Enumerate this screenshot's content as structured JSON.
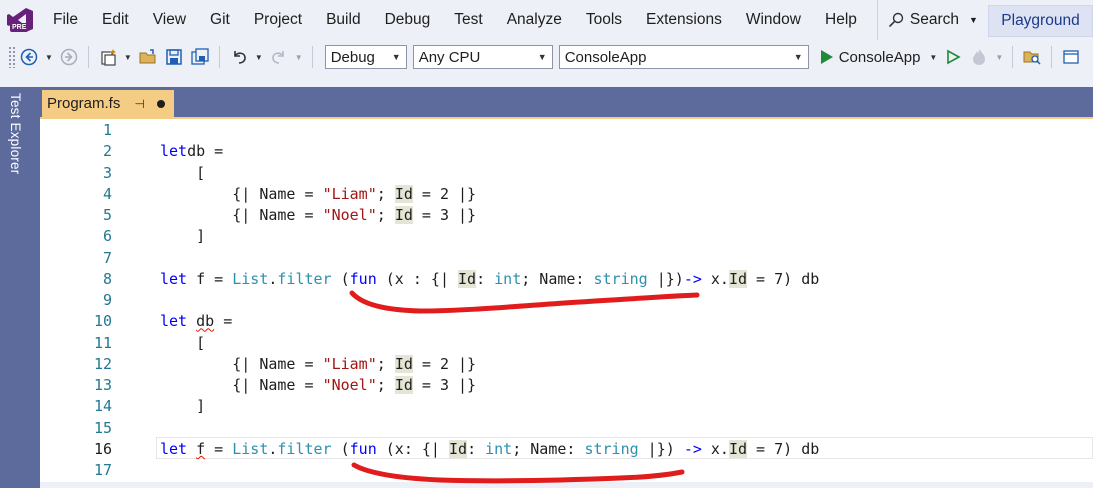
{
  "app": {
    "logo_badge": "PRE",
    "menu": [
      "File",
      "Edit",
      "View",
      "Git",
      "Project",
      "Build",
      "Debug",
      "Test",
      "Analyze",
      "Tools",
      "Extensions",
      "Window",
      "Help"
    ],
    "search_label": "Search",
    "playground_label": "Playground"
  },
  "toolbar": {
    "configuration": "Debug",
    "platform": "Any CPU",
    "project": "ConsoleApp",
    "run_label": "ConsoleApp"
  },
  "side_panel": {
    "label": "Test Explorer"
  },
  "document_tab": {
    "filename": "Program.fs",
    "modified": true
  },
  "editor": {
    "current_line": 16,
    "lines": [
      {
        "n": "1",
        "code": []
      },
      {
        "n": "2",
        "code": [
          [
            "kw",
            "let"
          ],
          [
            "",
            "db ="
          ]
        ]
      },
      {
        "n": "3",
        "code": [
          [
            "",
            "    ["
          ]
        ]
      },
      {
        "n": "4",
        "code": [
          [
            "",
            "        {| Name = "
          ],
          [
            "str",
            "\"Liam\""
          ],
          [
            "",
            "; "
          ],
          [
            "hl",
            "Id"
          ],
          [
            "",
            " = 2 |}"
          ]
        ]
      },
      {
        "n": "5",
        "code": [
          [
            "",
            "        {| Name = "
          ],
          [
            "str",
            "\"Noel\""
          ],
          [
            "",
            "; "
          ],
          [
            "hl",
            "Id"
          ],
          [
            "",
            " = 3 |}"
          ]
        ]
      },
      {
        "n": "6",
        "code": [
          [
            "",
            "    ]"
          ]
        ]
      },
      {
        "n": "7",
        "code": []
      },
      {
        "n": "8",
        "code": [
          [
            "kw",
            "let"
          ],
          [
            "",
            " f = "
          ],
          [
            "ty",
            "List"
          ],
          [
            "",
            "."
          ],
          [
            "ty",
            "filter"
          ],
          [
            "",
            " ("
          ],
          [
            "kw",
            "fun"
          ],
          [
            "",
            " (x : {| "
          ],
          [
            "hl",
            "Id"
          ],
          [
            "",
            ": "
          ],
          [
            "ty",
            "int"
          ],
          [
            "",
            "; Name: "
          ],
          [
            "ty",
            "string"
          ],
          [
            "",
            " |})"
          ],
          [
            "kw",
            "->"
          ],
          [
            "",
            " x."
          ],
          [
            "hl",
            "Id"
          ],
          [
            "",
            " = 7) db"
          ]
        ]
      },
      {
        "n": "9",
        "code": []
      },
      {
        "n": "10",
        "code": [
          [
            "kw",
            "let"
          ],
          [
            "",
            " "
          ],
          [
            "sq",
            "db"
          ],
          [
            "",
            " ="
          ]
        ]
      },
      {
        "n": "11",
        "code": [
          [
            "",
            "    ["
          ]
        ]
      },
      {
        "n": "12",
        "code": [
          [
            "",
            "        {| Name = "
          ],
          [
            "str",
            "\"Liam\""
          ],
          [
            "",
            "; "
          ],
          [
            "hl",
            "Id"
          ],
          [
            "",
            " = 2 |}"
          ]
        ]
      },
      {
        "n": "13",
        "code": [
          [
            "",
            "        {| Name = "
          ],
          [
            "str",
            "\"Noel\""
          ],
          [
            "",
            "; "
          ],
          [
            "hl",
            "Id"
          ],
          [
            "",
            " = 3 |}"
          ]
        ]
      },
      {
        "n": "14",
        "code": [
          [
            "",
            "    ]"
          ]
        ]
      },
      {
        "n": "15",
        "code": []
      },
      {
        "n": "16",
        "code": [
          [
            "kw",
            "let"
          ],
          [
            "",
            " "
          ],
          [
            "sq",
            "f"
          ],
          [
            "",
            " = "
          ],
          [
            "ty",
            "List"
          ],
          [
            "",
            "."
          ],
          [
            "ty",
            "filter"
          ],
          [
            "",
            " ("
          ],
          [
            "kw",
            "fun"
          ],
          [
            "",
            " (x: {| "
          ],
          [
            "hl",
            "Id"
          ],
          [
            "",
            ": "
          ],
          [
            "ty",
            "int"
          ],
          [
            "",
            "; Name: "
          ],
          [
            "ty",
            "string"
          ],
          [
            "",
            " |}) "
          ],
          [
            "kw",
            "->"
          ],
          [
            "",
            " x."
          ],
          [
            "hl",
            "Id"
          ],
          [
            "",
            " = 7) db"
          ]
        ]
      },
      {
        "n": "17",
        "code": []
      }
    ]
  },
  "colors": {
    "accent_tab": "#f5cc84",
    "chrome": "#5c6b9c",
    "annotation": "#e01c1c",
    "keyword": "#0000ff",
    "type": "#2b91af",
    "string": "#a31515"
  }
}
